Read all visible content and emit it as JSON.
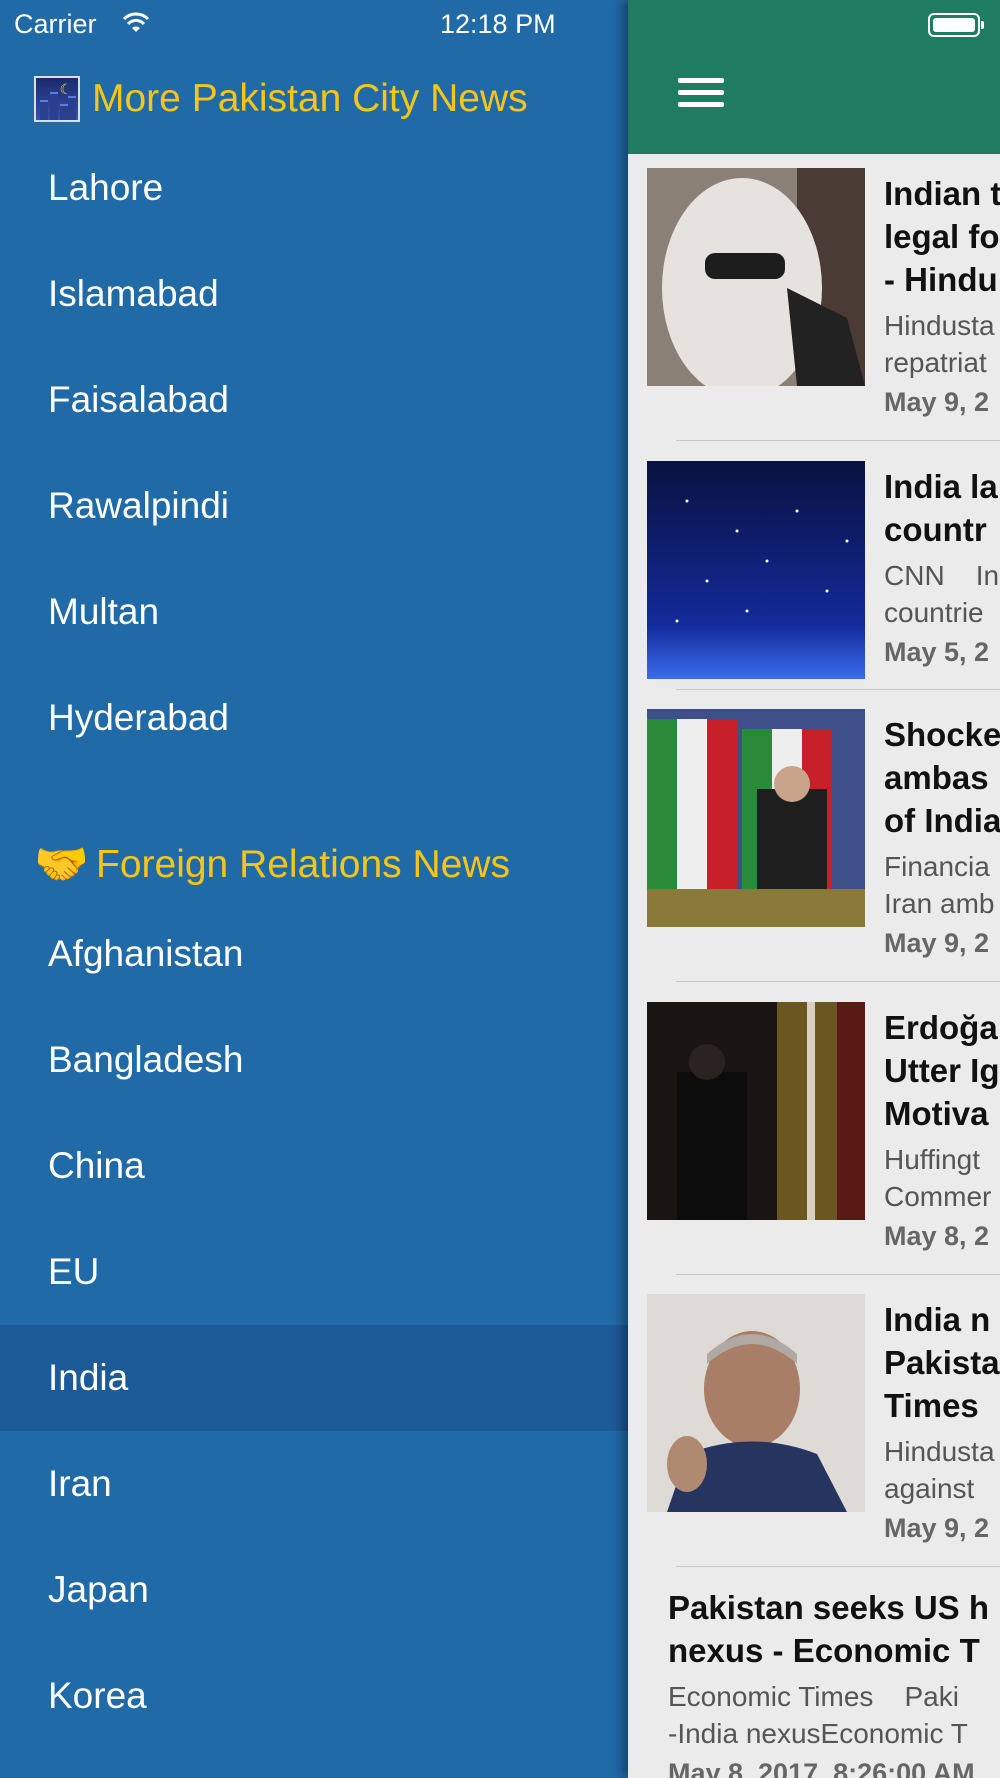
{
  "status_bar": {
    "carrier": "Carrier",
    "time": "12:18 PM"
  },
  "drawer": {
    "section1_title": "More Pakistan City News",
    "cities": [
      "Lahore",
      "Islamabad",
      "Faisalabad",
      "Rawalpindi",
      "Multan",
      "Hyderabad"
    ],
    "section2_title": "Foreign Relations News",
    "countries": [
      "Afghanistan",
      "Bangladesh",
      "China",
      "EU",
      "India",
      "Iran",
      "Japan",
      "Korea"
    ],
    "selected": "India"
  },
  "articles": [
    {
      "headline": [
        "Indian t",
        "legal fo",
        "- Hindu"
      ],
      "source": [
        "Hindusta",
        "repatriat"
      ],
      "date": "May 9, 2"
    },
    {
      "headline": [
        "India la",
        "countr"
      ],
      "source": [
        "CNN    In",
        "countrie"
      ],
      "date": "May 5, 2"
    },
    {
      "headline": [
        "Shocke",
        "ambas",
        "of India"
      ],
      "source": [
        "Financia",
        "Iran amb"
      ],
      "date": "May 9, 2"
    },
    {
      "headline": [
        "Erdoğa",
        "Utter Ig",
        "Motiva"
      ],
      "source": [
        "Huffingt",
        "Commer"
      ],
      "date": "May 8, 2"
    },
    {
      "headline": [
        "India n",
        "Pakista",
        "Times"
      ],
      "source": [
        "Hindusta",
        "against"
      ],
      "date": "May 9, 2"
    }
  ],
  "last_article": {
    "headline": [
      "Pakistan seeks US h",
      "nexus - Economic T"
    ],
    "source": [
      "Economic Times    Paki",
      "-India nexusEconomic T"
    ],
    "date": "May 8, 2017, 8:26:00 AM"
  },
  "colors": {
    "drawer_bg": "#216aa8",
    "selected_bg": "#1d5a98",
    "section_title": "#f5c518",
    "appbar": "#1f7c61"
  }
}
